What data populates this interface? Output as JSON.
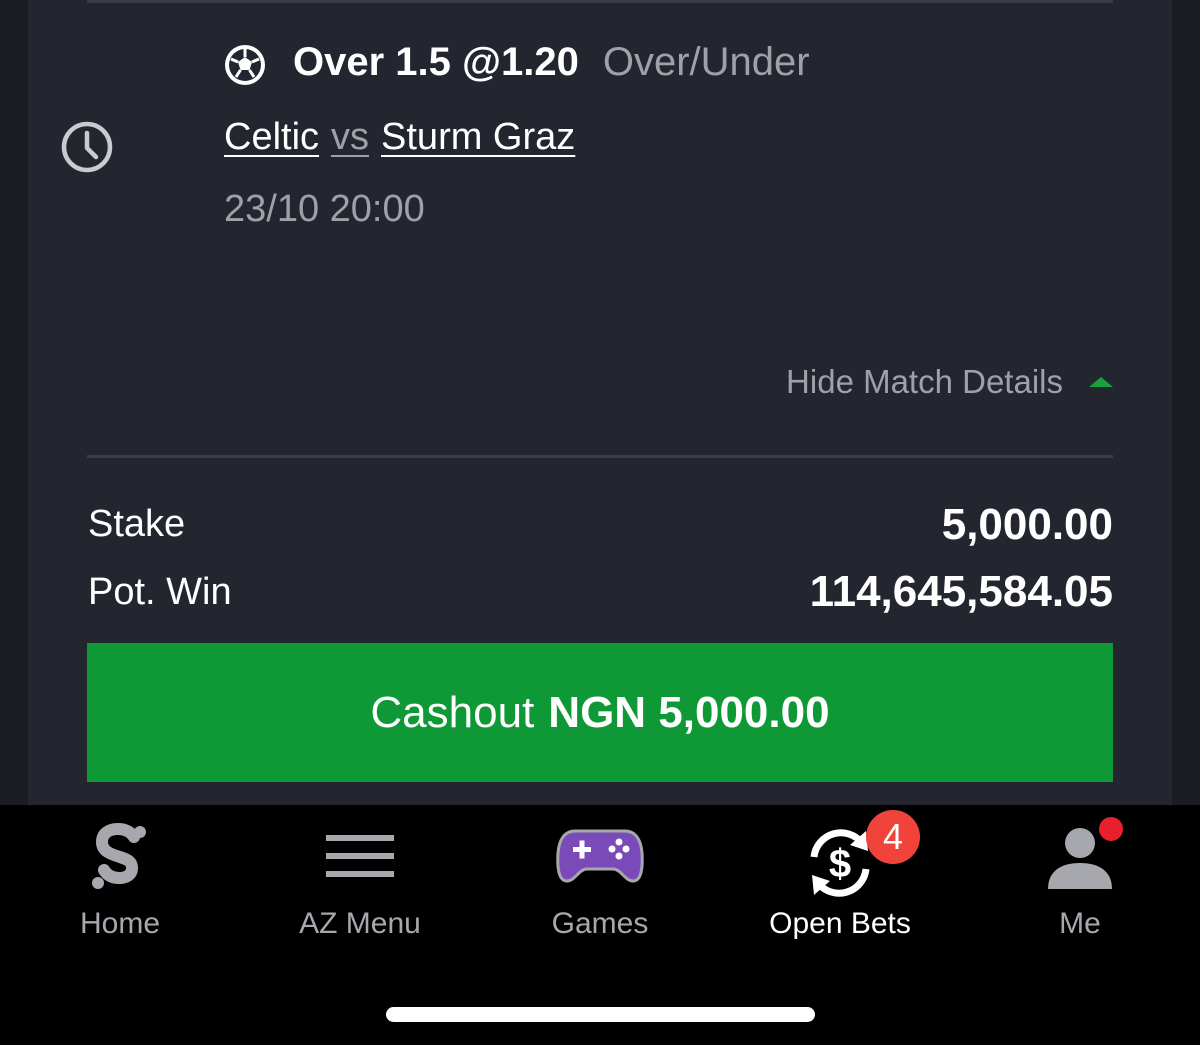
{
  "selection": {
    "pick": "Over 1.5 @1.20",
    "market": "Over/Under",
    "home_team": "Celtic",
    "vs": "vs",
    "away_team": "Sturm Graz",
    "kickoff": "23/10 20:00"
  },
  "details_toggle": {
    "label": "Hide Match Details"
  },
  "summary": {
    "stake_label": "Stake",
    "stake_value": "5,000.00",
    "pot_win_label": "Pot. Win",
    "pot_win_value": "114,645,584.05"
  },
  "cashout": {
    "label": "Cashout",
    "amount": "NGN 5,000.00"
  },
  "nav": {
    "items": [
      {
        "label": "Home",
        "icon": "sporty-s-icon"
      },
      {
        "label": "AZ Menu",
        "icon": "hamburger-menu-icon"
      },
      {
        "label": "Games",
        "icon": "gamepad-icon"
      },
      {
        "label": "Open Bets",
        "icon": "cashout-dollar-icon",
        "badge": "4",
        "active": true
      },
      {
        "label": "Me",
        "icon": "user-icon"
      }
    ]
  },
  "colors": {
    "accent_green": "#0f9936",
    "background": "#23262f",
    "badge_red": "#f0443a",
    "games_purple": "#7a4bb8"
  }
}
